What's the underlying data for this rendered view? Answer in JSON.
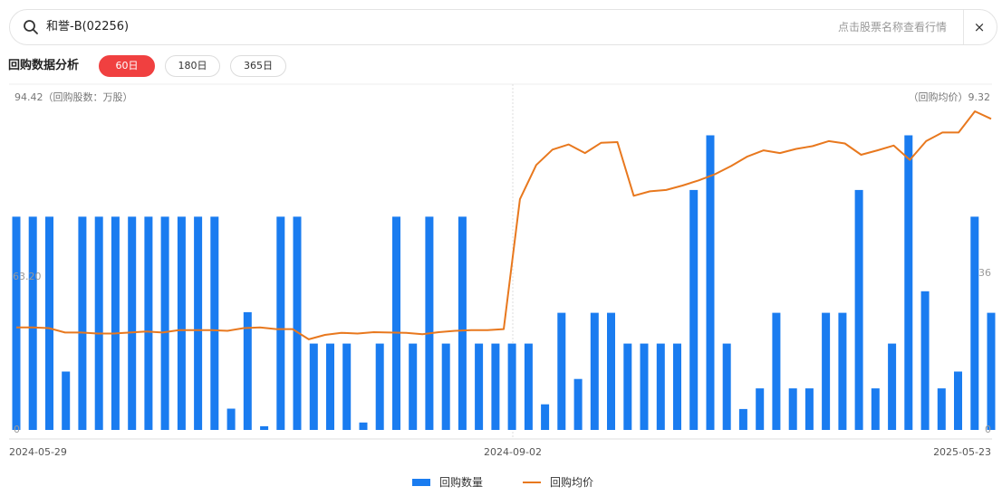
{
  "search": {
    "value": "和誉-B(02256)",
    "placeholder": "点击股票名称查看行情",
    "close_symbol": "×"
  },
  "toolbar": {
    "title": "回购数据分析",
    "periods": [
      "60日",
      "180日",
      "365日"
    ],
    "active_period": "60日"
  },
  "colors": {
    "bar": "#1a7cf0",
    "line": "#e8781e",
    "active": "#f04040"
  },
  "chart_data": {
    "type": "bar+line",
    "left_axis_label": "94.42（回购股数：万股）",
    "right_axis_label": "（回购均价）9.32",
    "left_mid_label": "63.20",
    "right_mid_label": "36",
    "left_bottom_label": "0",
    "right_bottom_label": "0",
    "x_tick_labels": [
      "2024-05-29",
      "2024-09-02",
      "2025-05-23"
    ],
    "ylim_left": [
      0,
      94.42
    ],
    "series": [
      {
        "name": "回购数量",
        "type": "bar",
        "values": [
          63.2,
          63.2,
          63.2,
          17.3,
          63.2,
          63.2,
          63.2,
          63.2,
          63.2,
          63.2,
          63.2,
          63.2,
          63.2,
          6.3,
          34.9,
          1.1,
          63.2,
          63.2,
          25.6,
          25.6,
          25.6,
          2.2,
          25.6,
          63.2,
          25.6,
          63.2,
          25.6,
          63.2,
          25.6,
          25.6,
          25.6,
          25.6,
          7.6,
          34.7,
          15.1,
          34.7,
          34.7,
          25.6,
          25.6,
          25.6,
          25.6,
          71.1,
          87.3,
          25.6,
          6.2,
          12.3,
          34.7,
          12.3,
          12.3,
          34.7,
          34.7,
          71.1,
          12.3,
          25.6,
          87.3,
          41.1,
          12.3,
          17.3,
          63.2,
          34.7
        ]
      },
      {
        "name": "回购均价",
        "type": "line",
        "values": [
          3.0,
          3.0,
          2.98,
          2.85,
          2.85,
          2.82,
          2.82,
          2.85,
          2.88,
          2.85,
          2.92,
          2.92,
          2.92,
          2.9,
          2.98,
          3.0,
          2.95,
          2.95,
          2.65,
          2.78,
          2.84,
          2.82,
          2.86,
          2.85,
          2.84,
          2.8,
          2.86,
          2.9,
          2.92,
          2.92,
          2.95,
          6.75,
          7.75,
          8.2,
          8.35,
          8.1,
          8.4,
          8.42,
          6.85,
          6.98,
          7.02,
          7.15,
          7.3,
          7.48,
          7.72,
          8.0,
          8.18,
          8.1,
          8.22,
          8.3,
          8.45,
          8.38,
          8.05,
          8.18,
          8.32,
          7.9,
          8.45,
          8.7,
          8.7,
          9.32,
          9.1
        ]
      }
    ],
    "ylim_right": [
      0,
      9.32
    ],
    "legend": [
      "回购数量",
      "回购均价"
    ],
    "legend_position": "bottom-center"
  }
}
